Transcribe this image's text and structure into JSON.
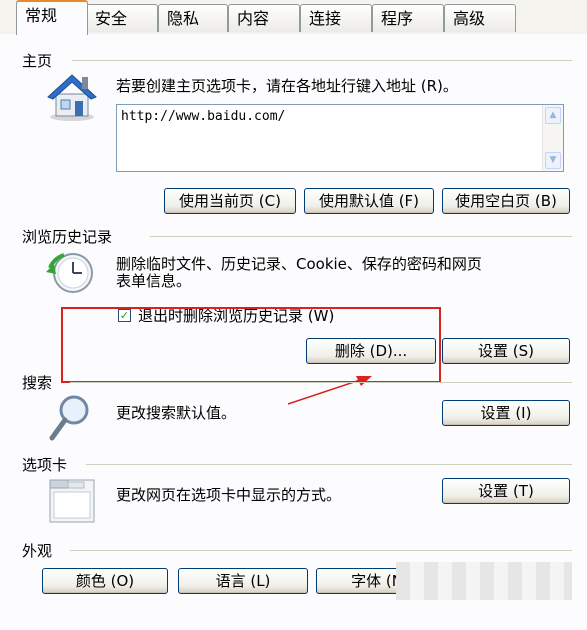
{
  "tabs": [
    "常规",
    "安全",
    "隐私",
    "内容",
    "连接",
    "程序",
    "高级"
  ],
  "homepage": {
    "title": "主页",
    "description": "若要创建主页选项卡，请在各地址行键入地址 (R)。",
    "url": "http://www.baidu.com/",
    "buttons": [
      "使用当前页 (C)",
      "使用默认值 (F)",
      "使用空白页 (B)"
    ]
  },
  "history": {
    "title": "浏览历史记录",
    "description_line1": "删除临时文件、历史记录、Cookie、保存的密码和网页",
    "description_line2": "表单信息。",
    "checkbox_label": "退出时删除浏览历史记录 (W)",
    "checkbox_checked": true,
    "delete_button": "删除 (D)...",
    "settings_button": "设置 (S)"
  },
  "search": {
    "title": "搜索",
    "description": "更改搜索默认值。",
    "settings_button": "设置 (I)"
  },
  "tabs_section": {
    "title": "选项卡",
    "description": "更改网页在选项卡中显示的方式。",
    "settings_button": "设置 (T)"
  },
  "appearance": {
    "title": "外观",
    "buttons": [
      "颜色 (O)",
      "语言 (L)",
      "字体 (N)"
    ]
  },
  "annotation_color": "#d9231f",
  "icons": [
    "home-icon",
    "history-clock-icon",
    "search-magnifier-icon",
    "tabs-window-icon"
  ]
}
